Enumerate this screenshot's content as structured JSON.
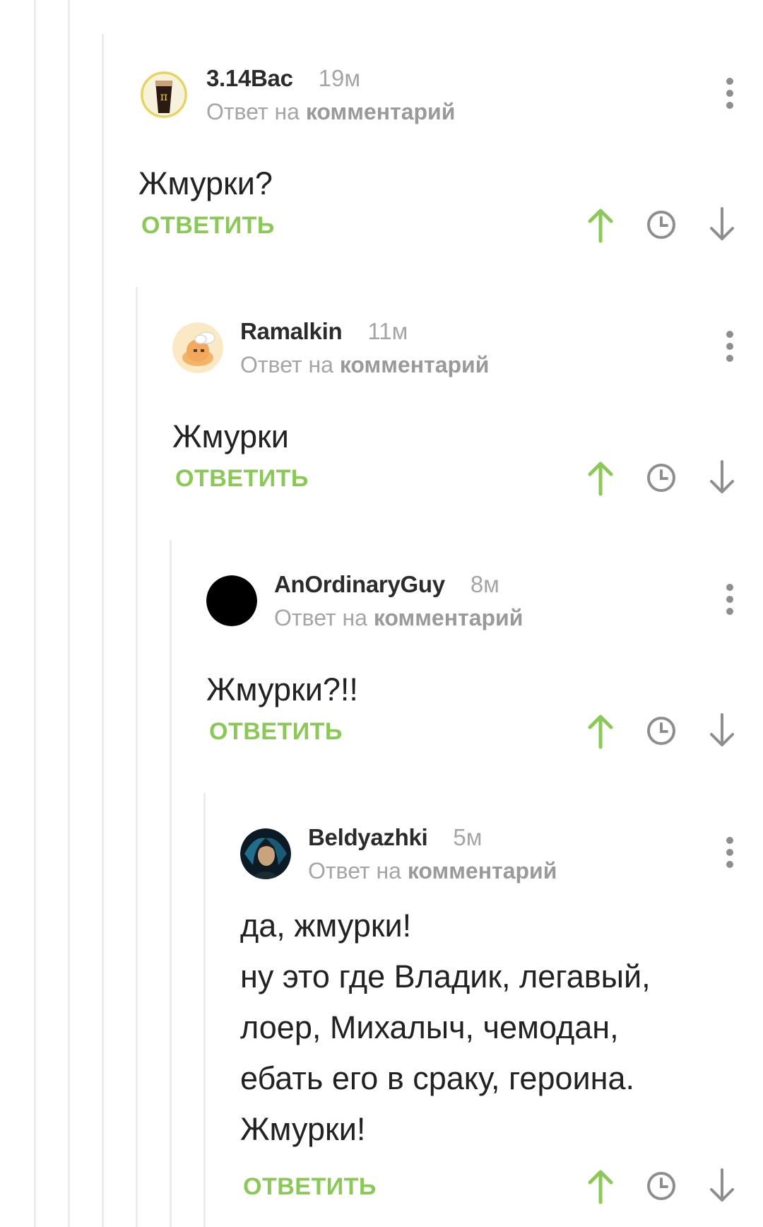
{
  "comments": [
    {
      "username": "3.14Вас",
      "time": "19м",
      "reply_prefix": "Ответ на",
      "reply_link": "комментарий",
      "text_lines": [
        "Жмурки?"
      ],
      "reply_label": "ОТВЕТИТЬ",
      "avatar_icon": "beer-glass-pi-avatar"
    },
    {
      "username": "Ramalkin",
      "time": "11м",
      "reply_prefix": "Ответ на",
      "reply_link": "комментарий",
      "text_lines": [
        "Жмурки"
      ],
      "reply_label": "ОТВЕТИТЬ",
      "avatar_icon": "chef-cartoon-avatar"
    },
    {
      "username": "AnOrdinaryGuy",
      "time": "8м",
      "reply_prefix": "Ответ на",
      "reply_link": "комментарий",
      "text_lines": [
        "Жмурки?!!"
      ],
      "reply_label": "ОТВЕТИТЬ",
      "avatar_icon": "black-circle-avatar"
    },
    {
      "username": "Beldyazhki",
      "time": "5м",
      "reply_prefix": "Ответ на",
      "reply_link": "комментарий",
      "text_lines": [
        "да, жмурки!",
        "ну это где Владик, легавый,",
        "лоер, Михалыч, чемодан,",
        "ебать его в сраку, героина.",
        "Жмурки!"
      ],
      "reply_label": "ОТВЕТИТЬ",
      "avatar_icon": "photo-portrait-avatar"
    }
  ],
  "icons": {
    "upvote": "arrow-up-icon",
    "save": "clock-icon",
    "downvote": "arrow-down-icon",
    "more": "more-vertical-icon"
  },
  "colors": {
    "accent_green": "#8ac858",
    "text": "#222222",
    "muted": "#a5a5a5",
    "icon_gray": "#8e8e8e",
    "thread_line": "#ececec"
  }
}
